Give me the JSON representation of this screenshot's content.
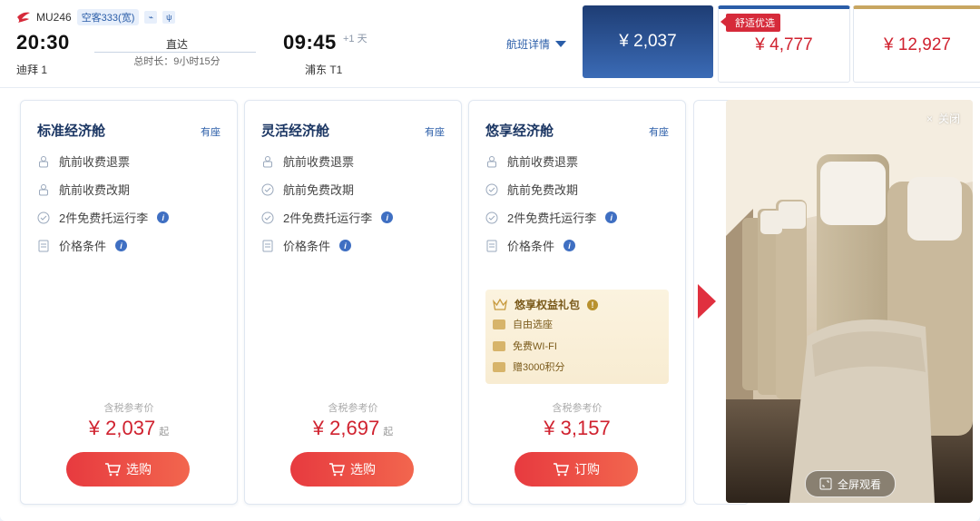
{
  "flight": {
    "number": "MU246",
    "aircraft": "空客333(宽)",
    "icons": [
      "wifi-icon",
      "meal-icon"
    ],
    "depart_time": "20:30",
    "depart_airport": "迪拜 1",
    "direct": "直达",
    "duration": "总时长：9小时15分",
    "arrive_time": "09:45",
    "plus_day": "+1 天",
    "arrive_airport": "浦东 T1",
    "details_label": "航班详情"
  },
  "price_tabs": [
    {
      "price": "¥ 2,037"
    },
    {
      "price": "¥ 4,777",
      "badge": "舒适优选"
    },
    {
      "price": "¥ 12,927"
    }
  ],
  "cards": [
    {
      "title": "标准经济舱",
      "seat": "有座",
      "rows": [
        {
          "text": "航前收费退票",
          "icon": "refund-fee-icon"
        },
        {
          "text": "航前收费改期",
          "icon": "change-fee-icon"
        },
        {
          "text": "2件免费托运行李",
          "icon": "check-circle-icon",
          "info": "i"
        },
        {
          "text": "价格条件",
          "icon": "document-icon",
          "info": "i"
        }
      ],
      "ref": "含税参考价",
      "price": "¥ 2,037",
      "price_suffix": "起",
      "button": "选购"
    },
    {
      "title": "灵活经济舱",
      "seat": "有座",
      "rows": [
        {
          "text": "航前收费退票",
          "icon": "refund-fee-icon"
        },
        {
          "text": "航前免费改期",
          "icon": "check-circle-icon"
        },
        {
          "text": "2件免费托运行李",
          "icon": "check-circle-icon",
          "info": "i"
        },
        {
          "text": "价格条件",
          "icon": "document-icon",
          "info": "i"
        }
      ],
      "ref": "含税参考价",
      "price": "¥ 2,697",
      "price_suffix": "起",
      "button": "选购"
    },
    {
      "title": "悠享经济舱",
      "seat": "有座",
      "rows": [
        {
          "text": "航前收费退票",
          "icon": "refund-fee-icon"
        },
        {
          "text": "航前免费改期",
          "icon": "check-circle-icon"
        },
        {
          "text": "2件免费托运行李",
          "icon": "check-circle-icon",
          "info": "i"
        },
        {
          "text": "价格条件",
          "icon": "document-icon",
          "info": "i"
        }
      ],
      "gift": {
        "title": "悠享权益礼包",
        "warn": "!",
        "items": [
          "自由选座",
          "免费WI-FI",
          "赠3000积分"
        ]
      },
      "ref": "含税参考价",
      "price": "¥ 3,157",
      "price_suffix": "",
      "button": "订购"
    }
  ],
  "photo": {
    "close_label": "关闭",
    "close_glyph": "×",
    "fullscreen_label": "全屏观看"
  }
}
